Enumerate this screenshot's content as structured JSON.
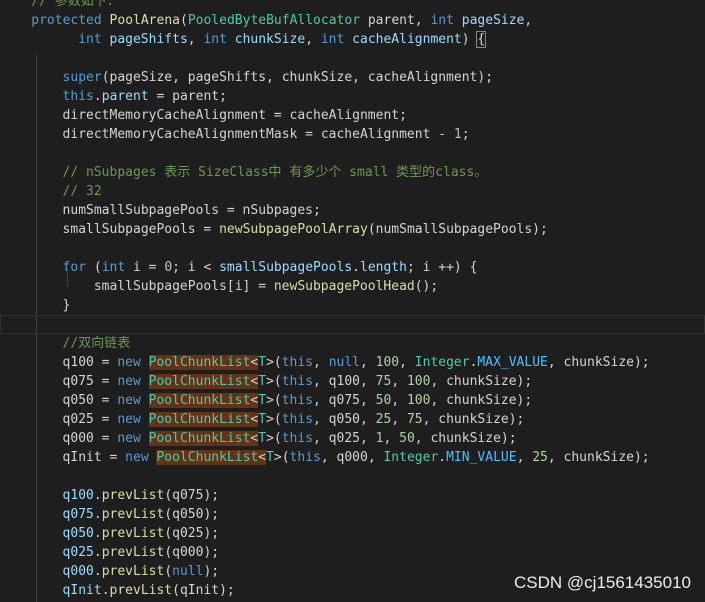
{
  "editor": {
    "lines": [
      {
        "indent": 4,
        "tokens": [
          {
            "t": "// 参数如下：",
            "c": "cm"
          }
        ],
        "partial": true
      },
      {
        "indent": 4,
        "tokens": [
          {
            "t": "protected ",
            "c": "kw"
          },
          {
            "t": "PoolArena",
            "c": "fn"
          },
          {
            "t": "(",
            "c": "pl"
          },
          {
            "t": "PooledByteBufAllocator",
            "c": "tp"
          },
          {
            "t": " parent, ",
            "c": "pl"
          },
          {
            "t": "int",
            "c": "kw"
          },
          {
            "t": " ",
            "c": "pl"
          },
          {
            "t": "pageSize",
            "c": "vr"
          },
          {
            "t": ",",
            "c": "pl"
          }
        ]
      },
      {
        "indent": 10,
        "tokens": [
          {
            "t": "int",
            "c": "kw"
          },
          {
            "t": " ",
            "c": "pl"
          },
          {
            "t": "pageShifts",
            "c": "vr"
          },
          {
            "t": ", ",
            "c": "pl"
          },
          {
            "t": "int",
            "c": "kw"
          },
          {
            "t": " ",
            "c": "pl"
          },
          {
            "t": "chunkSize",
            "c": "vr"
          },
          {
            "t": ", ",
            "c": "pl"
          },
          {
            "t": "int",
            "c": "kw"
          },
          {
            "t": " ",
            "c": "pl"
          },
          {
            "t": "cacheAlignment",
            "c": "vr"
          },
          {
            "t": ") ",
            "c": "pl"
          },
          {
            "t": "{",
            "c": "pl",
            "b": true
          }
        ]
      },
      {
        "indent": 0,
        "tokens": []
      },
      {
        "indent": 8,
        "tokens": [
          {
            "t": "super",
            "c": "kw"
          },
          {
            "t": "(pageSize, pageShifts, chunkSize, cacheAlignment);",
            "c": "pl"
          }
        ]
      },
      {
        "indent": 8,
        "tokens": [
          {
            "t": "this",
            "c": "kw"
          },
          {
            "t": ".",
            "c": "pl"
          },
          {
            "t": "parent",
            "c": "vr"
          },
          {
            "t": " = parent;",
            "c": "pl"
          }
        ]
      },
      {
        "indent": 8,
        "tokens": [
          {
            "t": "directMemoryCacheAlignment = cacheAlignment;",
            "c": "pl"
          }
        ]
      },
      {
        "indent": 8,
        "tokens": [
          {
            "t": "directMemoryCacheAlignmentMask = cacheAlignment - ",
            "c": "pl"
          },
          {
            "t": "1",
            "c": "num"
          },
          {
            "t": ";",
            "c": "pl"
          }
        ]
      },
      {
        "indent": 0,
        "tokens": []
      },
      {
        "indent": 8,
        "tokens": [
          {
            "t": "// nSubpages 表示 SizeClass中 有多少个 small 类型的class。",
            "c": "cm"
          }
        ]
      },
      {
        "indent": 8,
        "tokens": [
          {
            "t": "// 32",
            "c": "cm"
          }
        ]
      },
      {
        "indent": 8,
        "tokens": [
          {
            "t": "numSmallSubpagePools = nSubpages;",
            "c": "pl"
          }
        ]
      },
      {
        "indent": 8,
        "tokens": [
          {
            "t": "smallSubpagePools = ",
            "c": "pl"
          },
          {
            "t": "newSubpagePoolArray",
            "c": "fn"
          },
          {
            "t": "(numSmallSubpagePools);",
            "c": "pl"
          }
        ]
      },
      {
        "indent": 0,
        "tokens": []
      },
      {
        "indent": 8,
        "tokens": [
          {
            "t": "for",
            "c": "kw"
          },
          {
            "t": " (",
            "c": "pl"
          },
          {
            "t": "int",
            "c": "kw"
          },
          {
            "t": " i = ",
            "c": "pl"
          },
          {
            "t": "0",
            "c": "num"
          },
          {
            "t": "; i < ",
            "c": "pl"
          },
          {
            "t": "smallSubpagePools",
            "c": "vr"
          },
          {
            "t": ".",
            "c": "pl"
          },
          {
            "t": "length",
            "c": "vr"
          },
          {
            "t": "; i ++) {",
            "c": "pl"
          }
        ]
      },
      {
        "indent": 12,
        "tokens": [
          {
            "t": "smallSubpagePools[i] = ",
            "c": "pl"
          },
          {
            "t": "newSubpagePoolHead",
            "c": "fn"
          },
          {
            "t": "();",
            "c": "pl"
          }
        ]
      },
      {
        "indent": 8,
        "tokens": [
          {
            "t": "}",
            "c": "pl"
          }
        ]
      },
      {
        "indent": 0,
        "tokens": [],
        "current": true
      },
      {
        "indent": 8,
        "tokens": [
          {
            "t": "//双向链表",
            "c": "cm"
          }
        ]
      },
      {
        "indent": 8,
        "tokens": [
          {
            "t": "q100 = ",
            "c": "pl"
          },
          {
            "t": "new",
            "c": "kw"
          },
          {
            "t": " ",
            "c": "pl"
          },
          {
            "t": "PoolChunkList",
            "c": "tp",
            "hl": true
          },
          {
            "t": "<",
            "c": "pl",
            "hl": true
          },
          {
            "t": "T",
            "c": "tp"
          },
          {
            "t": ">(",
            "c": "pl"
          },
          {
            "t": "this",
            "c": "kw"
          },
          {
            "t": ", ",
            "c": "pl"
          },
          {
            "t": "null",
            "c": "kw"
          },
          {
            "t": ", ",
            "c": "pl"
          },
          {
            "t": "100",
            "c": "num"
          },
          {
            "t": ", ",
            "c": "pl"
          },
          {
            "t": "Integer",
            "c": "tp"
          },
          {
            "t": ".",
            "c": "pl"
          },
          {
            "t": "MAX_VALUE",
            "c": "cst"
          },
          {
            "t": ", chunkSize);",
            "c": "pl"
          }
        ]
      },
      {
        "indent": 8,
        "tokens": [
          {
            "t": "q075 = ",
            "c": "pl"
          },
          {
            "t": "new",
            "c": "kw"
          },
          {
            "t": " ",
            "c": "pl"
          },
          {
            "t": "PoolChunkList",
            "c": "tp",
            "hl": true
          },
          {
            "t": "<",
            "c": "pl",
            "hl": true
          },
          {
            "t": "T",
            "c": "tp"
          },
          {
            "t": ">(",
            "c": "pl"
          },
          {
            "t": "this",
            "c": "kw"
          },
          {
            "t": ", q100, ",
            "c": "pl"
          },
          {
            "t": "75",
            "c": "num"
          },
          {
            "t": ", ",
            "c": "pl"
          },
          {
            "t": "100",
            "c": "num"
          },
          {
            "t": ", chunkSize);",
            "c": "pl"
          }
        ]
      },
      {
        "indent": 8,
        "tokens": [
          {
            "t": "q050 = ",
            "c": "pl"
          },
          {
            "t": "new",
            "c": "kw"
          },
          {
            "t": " ",
            "c": "pl"
          },
          {
            "t": "PoolChunkList",
            "c": "tp",
            "hl": true
          },
          {
            "t": "<",
            "c": "pl",
            "hl": true
          },
          {
            "t": "T",
            "c": "tp"
          },
          {
            "t": ">(",
            "c": "pl"
          },
          {
            "t": "this",
            "c": "kw"
          },
          {
            "t": ", q075, ",
            "c": "pl"
          },
          {
            "t": "50",
            "c": "num"
          },
          {
            "t": ", ",
            "c": "pl"
          },
          {
            "t": "100",
            "c": "num"
          },
          {
            "t": ", chunkSize);",
            "c": "pl"
          }
        ]
      },
      {
        "indent": 8,
        "tokens": [
          {
            "t": "q025 = ",
            "c": "pl"
          },
          {
            "t": "new",
            "c": "kw"
          },
          {
            "t": " ",
            "c": "pl"
          },
          {
            "t": "PoolChunkList",
            "c": "tp",
            "hl": true
          },
          {
            "t": "<",
            "c": "pl",
            "hl": true
          },
          {
            "t": "T",
            "c": "tp"
          },
          {
            "t": ">(",
            "c": "pl"
          },
          {
            "t": "this",
            "c": "kw"
          },
          {
            "t": ", q050, ",
            "c": "pl"
          },
          {
            "t": "25",
            "c": "num"
          },
          {
            "t": ", ",
            "c": "pl"
          },
          {
            "t": "75",
            "c": "num"
          },
          {
            "t": ", chunkSize);",
            "c": "pl"
          }
        ]
      },
      {
        "indent": 8,
        "tokens": [
          {
            "t": "q000 = ",
            "c": "pl"
          },
          {
            "t": "new",
            "c": "kw"
          },
          {
            "t": " ",
            "c": "pl"
          },
          {
            "t": "PoolChunkList",
            "c": "tp",
            "hl": true
          },
          {
            "t": "<",
            "c": "pl",
            "hl": true
          },
          {
            "t": "T",
            "c": "tp"
          },
          {
            "t": ">(",
            "c": "pl"
          },
          {
            "t": "this",
            "c": "kw"
          },
          {
            "t": ", q025, ",
            "c": "pl"
          },
          {
            "t": "1",
            "c": "num"
          },
          {
            "t": ", ",
            "c": "pl"
          },
          {
            "t": "50",
            "c": "num"
          },
          {
            "t": ", chunkSize);",
            "c": "pl"
          }
        ]
      },
      {
        "indent": 8,
        "tokens": [
          {
            "t": "qInit = ",
            "c": "pl"
          },
          {
            "t": "new",
            "c": "kw"
          },
          {
            "t": " ",
            "c": "pl"
          },
          {
            "t": "PoolChunkList",
            "c": "tp",
            "hl": true
          },
          {
            "t": "<",
            "c": "pl",
            "hl": true
          },
          {
            "t": "T",
            "c": "tp"
          },
          {
            "t": ">(",
            "c": "pl"
          },
          {
            "t": "this",
            "c": "kw"
          },
          {
            "t": ", q000, ",
            "c": "pl"
          },
          {
            "t": "Integer",
            "c": "tp"
          },
          {
            "t": ".",
            "c": "pl"
          },
          {
            "t": "MIN_VALUE",
            "c": "cst"
          },
          {
            "t": ", ",
            "c": "pl"
          },
          {
            "t": "25",
            "c": "num"
          },
          {
            "t": ", chunkSize);",
            "c": "pl"
          }
        ]
      },
      {
        "indent": 0,
        "tokens": []
      },
      {
        "indent": 8,
        "tokens": [
          {
            "t": "q100",
            "c": "vr"
          },
          {
            "t": ".",
            "c": "pl"
          },
          {
            "t": "prevList",
            "c": "fn"
          },
          {
            "t": "(q075);",
            "c": "pl"
          }
        ]
      },
      {
        "indent": 8,
        "tokens": [
          {
            "t": "q075",
            "c": "vr"
          },
          {
            "t": ".",
            "c": "pl"
          },
          {
            "t": "prevList",
            "c": "fn"
          },
          {
            "t": "(q050);",
            "c": "pl"
          }
        ]
      },
      {
        "indent": 8,
        "tokens": [
          {
            "t": "q050",
            "c": "vr"
          },
          {
            "t": ".",
            "c": "pl"
          },
          {
            "t": "prevList",
            "c": "fn"
          },
          {
            "t": "(q025);",
            "c": "pl"
          }
        ]
      },
      {
        "indent": 8,
        "tokens": [
          {
            "t": "q025",
            "c": "vr"
          },
          {
            "t": ".",
            "c": "pl"
          },
          {
            "t": "prevList",
            "c": "fn"
          },
          {
            "t": "(q000);",
            "c": "pl"
          }
        ]
      },
      {
        "indent": 8,
        "tokens": [
          {
            "t": "q000",
            "c": "vr"
          },
          {
            "t": ".",
            "c": "pl"
          },
          {
            "t": "prevList",
            "c": "fn"
          },
          {
            "t": "(",
            "c": "pl"
          },
          {
            "t": "null",
            "c": "kw"
          },
          {
            "t": ");",
            "c": "pl"
          }
        ]
      },
      {
        "indent": 8,
        "tokens": [
          {
            "t": "qInit",
            "c": "vr"
          },
          {
            "t": ".",
            "c": "pl"
          },
          {
            "t": "prevList",
            "c": "fn"
          },
          {
            "t": "(qInit);",
            "c": "pl"
          }
        ]
      }
    ]
  },
  "watermark": "CSDN @cj1561435010"
}
